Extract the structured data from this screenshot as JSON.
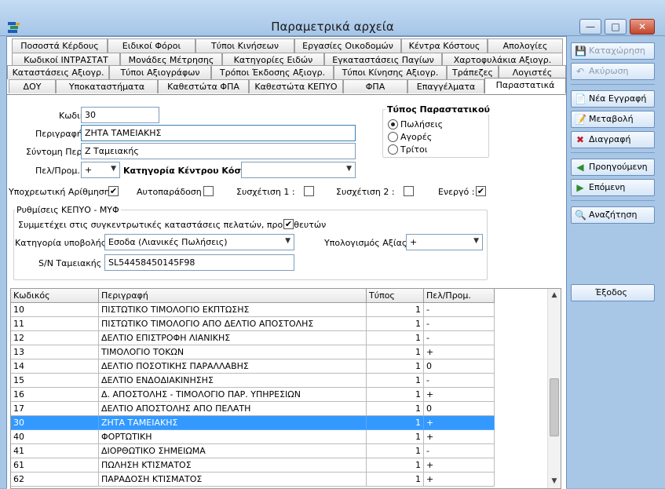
{
  "window": {
    "title": "Παραμετρικά αρχεία",
    "btn_min": "—",
    "btn_max": "□",
    "btn_close": "✕"
  },
  "tabs": {
    "row1": [
      "Ποσοστά Κέρδους",
      "Ειδικοί Φόροι",
      "Τύποι Κινήσεων",
      "Εργασίες Οικοδομών",
      "Κέντρα Κόστους",
      "Απολογίες"
    ],
    "row2": [
      "Κωδικοί ΙΝΤΡΑΣΤΑΤ",
      "Μονάδες Μέτρησης",
      "Κατηγορίες Ειδών",
      "Εγκαταστάσεις Παγίων",
      "Χαρτοφυλάκια Αξιογρ."
    ],
    "row3": [
      "Καταστάσεις Αξιογρ.",
      "Τύποι Αξιογράφων",
      "Τρόποι Έκδοσης Αξιογρ.",
      "Τύποι Κίνησης Αξιογρ.",
      "Τράπεζες",
      "Λογιστές"
    ],
    "row4": [
      "ΔΟΥ",
      "Υποκαταστήματα",
      "Καθεστώτα ΦΠΑ",
      "Καθεστώτα ΚΕΠΥΟ",
      "ΦΠΑ",
      "Επαγγέλματα",
      "Παραστατικά"
    ]
  },
  "form": {
    "code_label": "Κωδικός:",
    "code_value": "30",
    "descr_label": "Περιγραφή:",
    "descr_value": "ΖΗΤΑ ΤΑΜΕΙΑΚΗΣ",
    "short_label": "Σύντομη Περ.:",
    "short_value": "Ζ Ταμειακής",
    "pelprom_label": "Πελ/Προμ.:",
    "pelprom_value": "+",
    "costcat_label": "Κατηγορία Κέντρου Κόστους:",
    "costcat_value": "",
    "type_group": "Τύπος Παραστατικού",
    "type_options": [
      "Πωλήσεις",
      "Αγορές",
      "Τρίτοι"
    ],
    "type_selected": "Πωλήσεις",
    "mandatory_num_label": "Υποχρεωτική Αρίθμηση :",
    "mandatory_num_checked": true,
    "autodelivery_label": "Αυτοπαράδοση :",
    "autodelivery_checked": false,
    "rel1_label": "Συσχέτιση 1 :",
    "rel1_checked": false,
    "rel2_label": "Συσχέτιση 2 :",
    "rel2_checked": false,
    "active_label": "Ενεργό :",
    "active_checked": true,
    "kepyo_group": "Ρυθμίσεις ΚΕΠΥΟ - ΜΥΦ",
    "kepyo_participate_label": "Συμμετέχει στις συγκεντρωτικές καταστάσεις πελατών, προμηθευτών",
    "kepyo_participate_checked": true,
    "submit_cat_label": "Κατηγορία υποβολής :",
    "submit_cat_value": "Εσοδα (Λιανικές Πωλήσεις)",
    "calc_value_label": "Υπολογισμός Αξίας :",
    "calc_value_value": "+",
    "serial_label": "S/N Ταμειακής :",
    "serial_value": "SL54458450145F98"
  },
  "grid": {
    "headers": [
      "Κωδικός",
      "Περιγραφή",
      "Τύπος",
      "Πελ/Προμ."
    ],
    "rows": [
      {
        "code": "10",
        "descr": "ΠΙΣΤΩΤΙΚΟ ΤΙΜΟΛΟΓΙΟ ΕΚΠΤΩΣΗΣ",
        "type": "1",
        "pp": "-"
      },
      {
        "code": "11",
        "descr": "ΠΙΣΤΩΤΙΚΟ ΤΙΜΟΛΟΓΙΟ ΑΠΟ ΔΕΛΤΙΟ ΑΠΟΣΤΟΛΗΣ",
        "type": "1",
        "pp": "-"
      },
      {
        "code": "12",
        "descr": "ΔΕΛΤΙΟ ΕΠΙΣΤΡΟΦΗ ΛΙΑΝΙΚΗΣ",
        "type": "1",
        "pp": "-"
      },
      {
        "code": "13",
        "descr": "ΤΙΜΟΛΟΓΙΟ ΤΟΚΩΝ",
        "type": "1",
        "pp": "+"
      },
      {
        "code": "14",
        "descr": "ΔΕΛΤΙΟ ΠΟΣΟΤΙΚΗΣ ΠΑΡΑΛΛΑΒΗΣ",
        "type": "1",
        "pp": "0"
      },
      {
        "code": "15",
        "descr": "ΔΕΛΤΙΟ ΕΝΔΟΔΙΑΚΙΝΗΣΗΣ",
        "type": "1",
        "pp": "-"
      },
      {
        "code": "16",
        "descr": "Δ. ΑΠΟΣΤΟΛΗΣ - ΤΙΜΟΛΟΓΙΟ ΠΑΡ. ΥΠΗΡΕΣΙΩΝ",
        "type": "1",
        "pp": "+"
      },
      {
        "code": "17",
        "descr": "ΔΕΛΤΙΟ ΑΠΟΣΤΟΛΗΣ ΑΠΟ ΠΕΛΑΤΗ",
        "type": "1",
        "pp": "0"
      },
      {
        "code": "30",
        "descr": "ΖΗΤΑ ΤΑΜΕΙΑΚΗΣ",
        "type": "1",
        "pp": "+",
        "selected": true
      },
      {
        "code": "40",
        "descr": "ΦΟΡΤΩΤΙΚΗ",
        "type": "1",
        "pp": "+"
      },
      {
        "code": "41",
        "descr": "ΔΙΟΡΘΩΤΙΚΟ ΣΗΜΕΙΩΜΑ",
        "type": "1",
        "pp": "-"
      },
      {
        "code": "61",
        "descr": "ΠΩΛΗΣΗ ΚΤΙΣΜΑΤΟΣ",
        "type": "1",
        "pp": "+"
      },
      {
        "code": "62",
        "descr": "ΠΑΡΑΔΟΣΗ ΚΤΙΣΜΑΤΟΣ",
        "type": "1",
        "pp": "+"
      }
    ]
  },
  "sidebar": {
    "save": "Καταχώρηση",
    "cancel": "Ακύρωση",
    "new": "Νέα Εγγραφή",
    "edit": "Μεταβολή",
    "delete": "Διαγραφή",
    "prev": "Προηγούμενη",
    "next": "Επόμενη",
    "search": "Αναζήτηση",
    "exit": "Έξοδος"
  }
}
